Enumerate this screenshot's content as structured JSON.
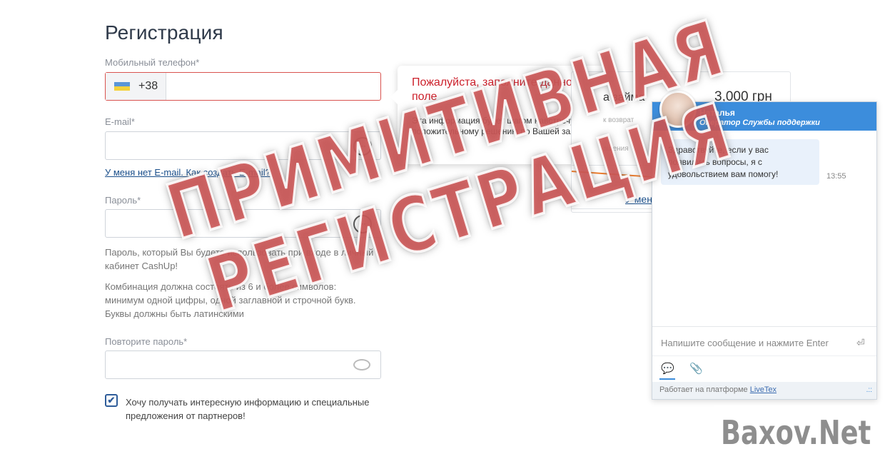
{
  "form": {
    "title": "Регистрация",
    "phone": {
      "label": "Мобильный телефон*",
      "prefix": "+38",
      "value": ""
    },
    "email": {
      "label": "E-mail*",
      "value": "",
      "no_email_link": "У меня нет E-mail. Как создать E-mail?"
    },
    "password": {
      "label": "Пароль*",
      "value": "",
      "hint1": "Пароль, который Вы будете использовать при входе в личный кабинет CashUp!",
      "hint2": "Комбинация должна состоять из 6 и более символов: минимум одной цифры, одной заглавной и строчной букв. Буквы должны быть латинскими"
    },
    "password_repeat": {
      "label": "Повторите пароль*",
      "value": ""
    },
    "offers_checkbox": {
      "checked": true,
      "label": "Хочу получать интересную информацию и специальные предложения от партнеров!"
    }
  },
  "tooltip": {
    "title": "Пожалуйста, заполните данное поле",
    "body": "Эта информация будет шагом навстречу положительному решению по Вашей заявке"
  },
  "loan": {
    "label": "а займа",
    "value": "3,000 грн",
    "small1": "к возврат",
    "small2": "ашения",
    "link": "У мен"
  },
  "chat": {
    "operator_name": "Наталья",
    "operator_role": "Оператор Службы поддержки",
    "message": "Здравствуйте, если у вас появились вопросы, я с удовольствием вам помогу!",
    "message_time": "13:55",
    "input_placeholder": "Напишите сообщение и нажмите Enter",
    "footer_text": "Работает на платформе",
    "footer_link": "LiveTex"
  },
  "watermark": {
    "line1": "ПРИМИТИВНАЯ",
    "line2": "РЕГИСТРАЦИЯ"
  },
  "logo": "Baxov.Net",
  "colors": {
    "error": "#cc1f2a",
    "accent": "#3c8ddc",
    "link": "#1a4f8b",
    "stamp": "#e85454"
  }
}
